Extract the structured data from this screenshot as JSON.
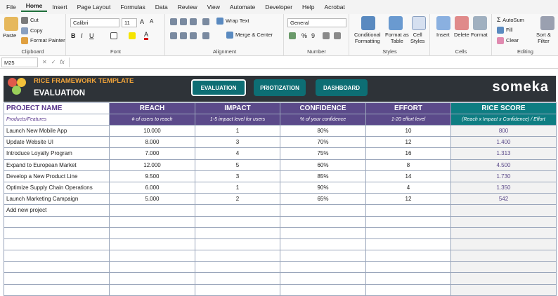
{
  "menu": [
    "File",
    "Home",
    "Insert",
    "Page Layout",
    "Formulas",
    "Data",
    "Review",
    "View",
    "Automate",
    "Developer",
    "Help",
    "Acrobat"
  ],
  "menu_active": "Home",
  "ribbon": {
    "clipboard": {
      "paste": "Paste",
      "cut": "Cut",
      "copy": "Copy",
      "format_painter": "Format Painter",
      "label": "Clipboard"
    },
    "font": {
      "name": "Calibri",
      "size": "11",
      "label": "Font"
    },
    "alignment": {
      "wrap": "Wrap Text",
      "merge": "Merge & Center",
      "label": "Alignment"
    },
    "number": {
      "format": "General",
      "label": "Number"
    },
    "styles": {
      "conditional": "Conditional",
      "conditional2": "Formatting",
      "format_table": "Format as",
      "format_table2": "Table",
      "cell_styles": "Cell",
      "cell_styles2": "Styles",
      "label": "Styles"
    },
    "cells": {
      "insert": "Insert",
      "delete": "Delete",
      "format": "Format",
      "label": "Cells"
    },
    "editing": {
      "autosum": "AutoSum",
      "fill": "Fill",
      "clear": "Clear",
      "sort": "Sort &",
      "sort2": "Filter",
      "label": "Editing"
    }
  },
  "formula_bar": {
    "cell_ref": "M25",
    "fx": "fx"
  },
  "sheet": {
    "title": "RICE FRAMEWORK TEMPLATE",
    "subtitle": "EVALUATION",
    "nav": [
      "EVALUATION",
      "PRIOTIZATION",
      "DASHBOARD"
    ],
    "logo": "someka",
    "columns": [
      {
        "header": "PROJECT NAME",
        "sub": "Products/Features"
      },
      {
        "header": "REACH",
        "sub": "# of users to reach"
      },
      {
        "header": "IMPACT",
        "sub": "1-5 impact level for users"
      },
      {
        "header": "CONFIDENCE",
        "sub": "% of your confidence"
      },
      {
        "header": "EFFORT",
        "sub": "1-20 effort level"
      },
      {
        "header": "RICE SCORE",
        "sub": "(Reach x Impact x Confidence) / Effort"
      }
    ],
    "rows": [
      [
        "Launch New Mobile App",
        "10.000",
        "1",
        "80%",
        "10",
        "800"
      ],
      [
        "Update Website UI",
        "8.000",
        "3",
        "70%",
        "12",
        "1.400"
      ],
      [
        "Introduce Loyalty Program",
        "7.000",
        "4",
        "75%",
        "16",
        "1.313"
      ],
      [
        "Expand to European Market",
        "12.000",
        "5",
        "60%",
        "8",
        "4.500"
      ],
      [
        "Develop a New Product Line",
        "9.500",
        "3",
        "85%",
        "14",
        "1.730"
      ],
      [
        "Optimize Supply Chain Operations",
        "6.000",
        "1",
        "90%",
        "4",
        "1.350"
      ],
      [
        "Launch Marketing Campaign",
        "5.000",
        "2",
        "65%",
        "12",
        "542"
      ],
      [
        "Add new project",
        "",
        "",
        "",
        "",
        ""
      ]
    ]
  }
}
